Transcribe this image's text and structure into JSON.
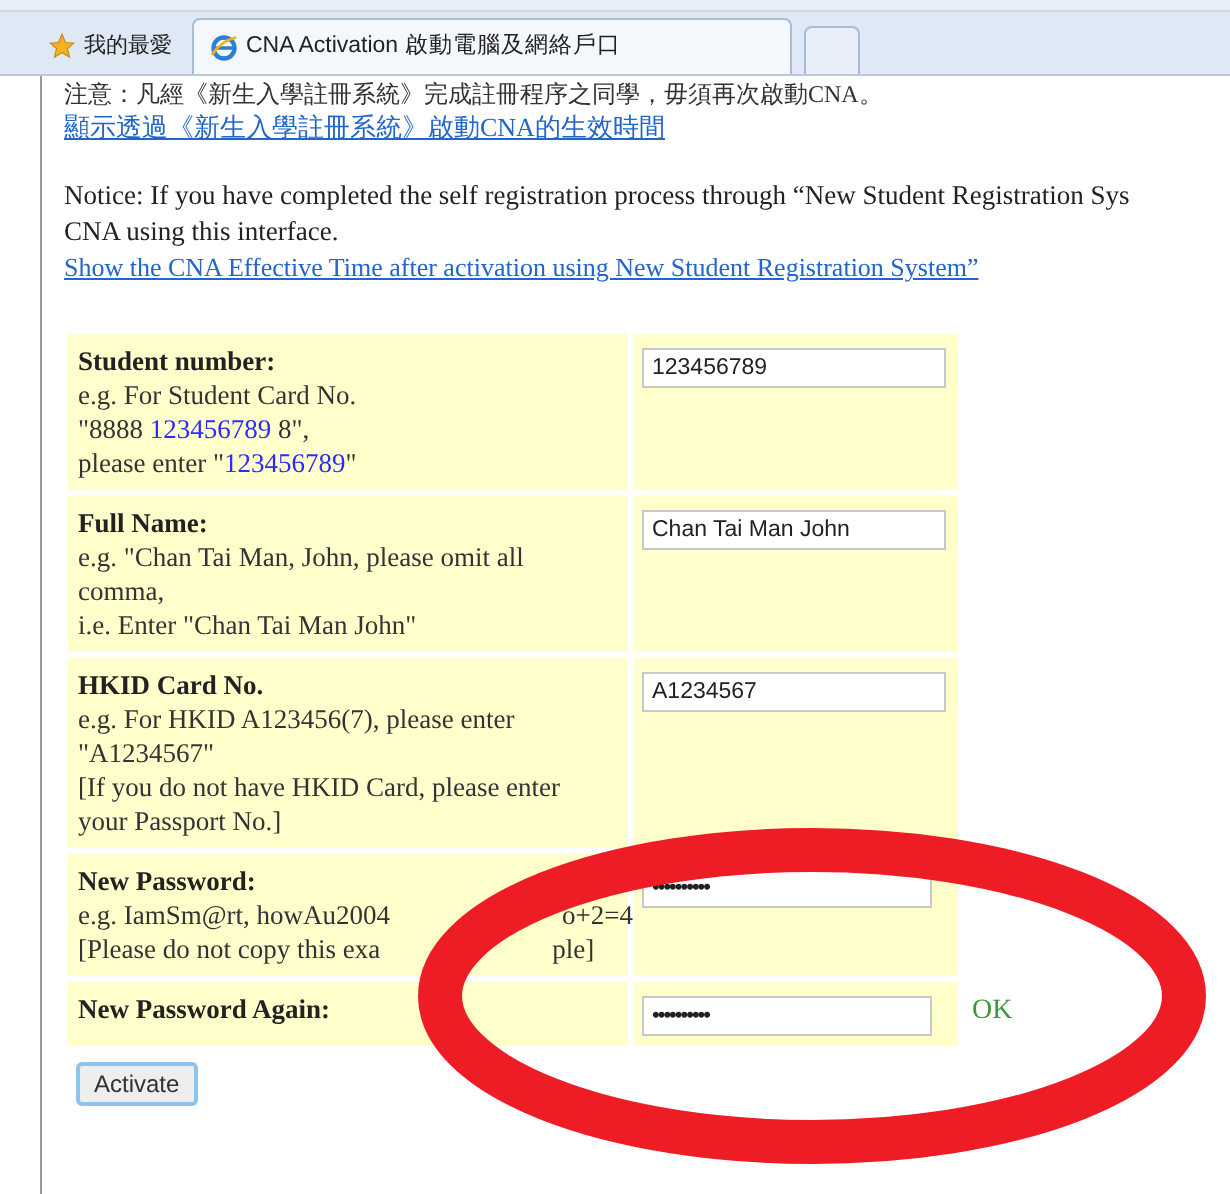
{
  "browser": {
    "favorites": "我的最愛",
    "tabs": [
      {
        "title": "CNA Activation 啟動電腦及網絡戶口",
        "selected": true
      }
    ]
  },
  "notice_zh": "注意：凡經《新生入學註冊系統》完成註冊程序之同學，毋須再次啟動CNA。",
  "link_zh": "顯示透過《新生入學註冊系統》啟動CNA的生效時間",
  "notice_en": [
    "Notice: If you have completed the self registration process through “New Student Registration Sys",
    "CNA using this interface."
  ],
  "link_en": "Show the CNA Effective Time after activation using New Student Registration System”",
  "fields": [
    {
      "label": "Student number:",
      "hint": [
        {
          "kind": "text",
          "parts": [
            {
              "t": "e.g. For Student Card No."
            }
          ]
        },
        {
          "kind": "text",
          "parts": [
            {
              "t": "\"8888 "
            },
            {
              "t": "123456789",
              "blue": true
            },
            {
              "t": " 8\","
            }
          ]
        },
        {
          "kind": "text",
          "parts": [
            {
              "t": "please enter \""
            },
            {
              "t": "123456789",
              "blue": true
            },
            {
              "t": "\""
            }
          ]
        }
      ],
      "value": "123456789",
      "kind": "text"
    },
    {
      "label": "Full Name:",
      "hint": [
        {
          "kind": "text",
          "parts": [
            {
              "t": "e.g. \"Chan Tai Man, John, please omit all comma,"
            }
          ]
        },
        {
          "kind": "text",
          "parts": [
            {
              "t": "i.e. Enter \"Chan Tai Man John\""
            }
          ]
        }
      ],
      "value": "Chan Tai Man John",
      "kind": "text"
    },
    {
      "label": "HKID Card No.",
      "hint": [
        {
          "kind": "text",
          "parts": [
            {
              "t": "e.g. For HKID A123456(7), please enter \"A1234567\""
            }
          ]
        },
        {
          "kind": "text",
          "parts": [
            {
              "t": "[If you do not have HKID Card, please enter your Passport No.]"
            }
          ]
        }
      ],
      "value": "A1234567",
      "kind": "text"
    },
    {
      "label": "New Password:",
      "hint": [
        {
          "kind": "covered",
          "parts": [
            {
              "t": "e.g. IamSm@rt, howAu2004"
            },
            {
              "t": "o+2=4"
            }
          ]
        },
        {
          "kind": "covered",
          "parts": [
            {
              "t": "[Please do not copy this exa"
            },
            {
              "t": "ple]"
            }
          ]
        }
      ],
      "value": "••••••••••",
      "kind": "password"
    },
    {
      "label": "New Password Again:",
      "value": "••••••••••",
      "kind": "password",
      "status": "OK"
    }
  ],
  "button": "Activate"
}
